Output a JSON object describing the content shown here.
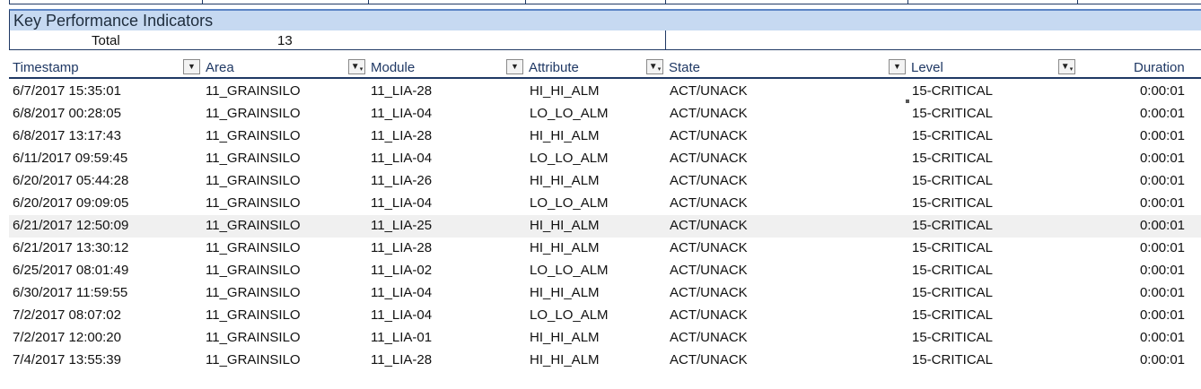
{
  "kpi": {
    "title": "Key Performance Indicators",
    "total_label": "Total",
    "total_value": "13"
  },
  "columns": [
    {
      "label": "Timestamp",
      "filter": "dropdown"
    },
    {
      "label": "Area",
      "filter": "filtered"
    },
    {
      "label": "Module",
      "filter": "dropdown"
    },
    {
      "label": "Attribute",
      "filter": "filtered"
    },
    {
      "label": "State",
      "filter": "dropdown"
    },
    {
      "label": "Level",
      "filter": "filtered"
    },
    {
      "label": "Duration",
      "filter": "none"
    }
  ],
  "rows": [
    {
      "timestamp": "6/7/2017 15:35:01",
      "area": "11_GRAINSILO",
      "module": "11_LIA-28",
      "attribute": "HI_HI_ALM",
      "state": "ACT/UNACK",
      "level": "15-CRITICAL",
      "duration": "0:00:01"
    },
    {
      "timestamp": "6/8/2017 00:28:05",
      "area": "11_GRAINSILO",
      "module": "11_LIA-04",
      "attribute": "LO_LO_ALM",
      "state": "ACT/UNACK",
      "level": "15-CRITICAL",
      "duration": "0:00:01"
    },
    {
      "timestamp": "6/8/2017 13:17:43",
      "area": "11_GRAINSILO",
      "module": "11_LIA-28",
      "attribute": "HI_HI_ALM",
      "state": "ACT/UNACK",
      "level": "15-CRITICAL",
      "duration": "0:00:01"
    },
    {
      "timestamp": "6/11/2017 09:59:45",
      "area": "11_GRAINSILO",
      "module": "11_LIA-04",
      "attribute": "LO_LO_ALM",
      "state": "ACT/UNACK",
      "level": "15-CRITICAL",
      "duration": "0:00:01"
    },
    {
      "timestamp": "6/20/2017 05:44:28",
      "area": "11_GRAINSILO",
      "module": "11_LIA-26",
      "attribute": "HI_HI_ALM",
      "state": "ACT/UNACK",
      "level": "15-CRITICAL",
      "duration": "0:00:01"
    },
    {
      "timestamp": "6/20/2017 09:09:05",
      "area": "11_GRAINSILO",
      "module": "11_LIA-04",
      "attribute": "LO_LO_ALM",
      "state": "ACT/UNACK",
      "level": "15-CRITICAL",
      "duration": "0:00:01"
    },
    {
      "timestamp": "6/21/2017 12:50:09",
      "area": "11_GRAINSILO",
      "module": "11_LIA-25",
      "attribute": "HI_HI_ALM",
      "state": "ACT/UNACK",
      "level": "15-CRITICAL",
      "duration": "0:00:01"
    },
    {
      "timestamp": "6/21/2017 13:30:12",
      "area": "11_GRAINSILO",
      "module": "11_LIA-28",
      "attribute": "HI_HI_ALM",
      "state": "ACT/UNACK",
      "level": "15-CRITICAL",
      "duration": "0:00:01"
    },
    {
      "timestamp": "6/25/2017 08:01:49",
      "area": "11_GRAINSILO",
      "module": "11_LIA-02",
      "attribute": "LO_LO_ALM",
      "state": "ACT/UNACK",
      "level": "15-CRITICAL",
      "duration": "0:00:01"
    },
    {
      "timestamp": "6/30/2017 11:59:55",
      "area": "11_GRAINSILO",
      "module": "11_LIA-04",
      "attribute": "HI_HI_ALM",
      "state": "ACT/UNACK",
      "level": "15-CRITICAL",
      "duration": "0:00:01"
    },
    {
      "timestamp": "7/2/2017 08:07:02",
      "area": "11_GRAINSILO",
      "module": "11_LIA-04",
      "attribute": "LO_LO_ALM",
      "state": "ACT/UNACK",
      "level": "15-CRITICAL",
      "duration": "0:00:01"
    },
    {
      "timestamp": "7/2/2017 12:00:20",
      "area": "11_GRAINSILO",
      "module": "11_LIA-01",
      "attribute": "HI_HI_ALM",
      "state": "ACT/UNACK",
      "level": "15-CRITICAL",
      "duration": "0:00:01"
    },
    {
      "timestamp": "7/4/2017 13:55:39",
      "area": "11_GRAINSILO",
      "module": "11_LIA-28",
      "attribute": "HI_HI_ALM",
      "state": "ACT/UNACK",
      "level": "15-CRITICAL",
      "duration": "0:00:01"
    }
  ],
  "highlighted_row": 6
}
